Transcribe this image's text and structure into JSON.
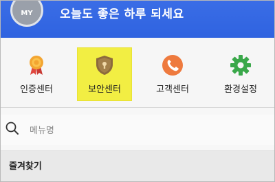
{
  "header": {
    "avatar_text": "MY",
    "greeting": "오늘도 좋은 하루 되세요"
  },
  "menu": {
    "items": [
      {
        "label": "인증센터",
        "icon": "certificate-medal-icon",
        "selected": false
      },
      {
        "label": "보안센터",
        "icon": "shield-lock-icon",
        "selected": true
      },
      {
        "label": "고객센터",
        "icon": "phone-icon",
        "selected": false
      },
      {
        "label": "환경설정",
        "icon": "gear-icon",
        "selected": false
      }
    ]
  },
  "search": {
    "placeholder": "메뉴명"
  },
  "favorites": {
    "label": "즐겨찾기"
  },
  "colors": {
    "header_blue": "#2f63e0",
    "highlight_yellow": "#f2ee43"
  }
}
